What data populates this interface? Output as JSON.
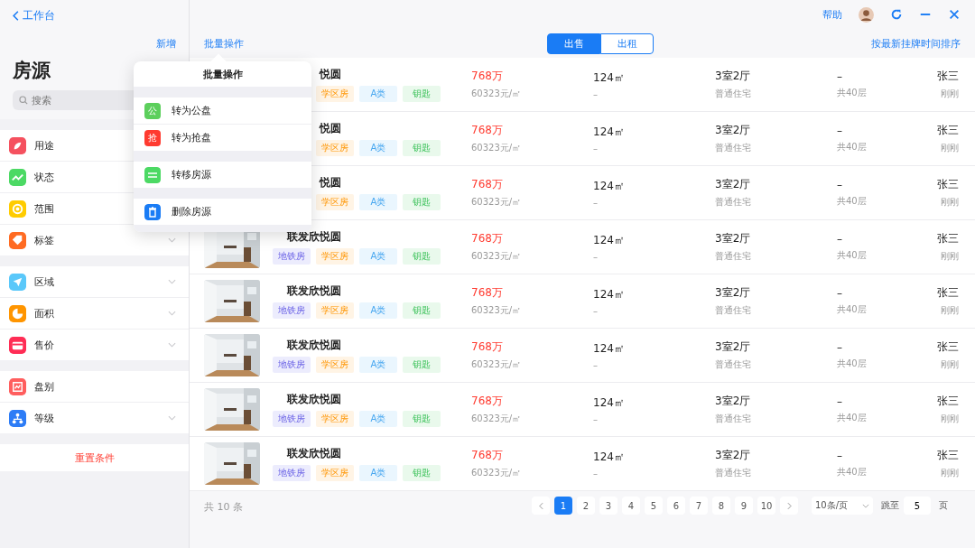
{
  "sidebar": {
    "back": "工作台",
    "add": "新增",
    "title": "房源",
    "search": {
      "placeholder": "搜索"
    },
    "groups": [
      {
        "items": [
          {
            "label": "用途",
            "kind": "leaf",
            "color": "#f5515f"
          },
          {
            "label": "状态",
            "kind": "trend",
            "color": "#4cd964"
          },
          {
            "label": "范围",
            "kind": "target",
            "color": "#ffcc00"
          },
          {
            "label": "标签",
            "kind": "tag",
            "color": "#ff6b22",
            "chevron": true
          }
        ]
      },
      {
        "items": [
          {
            "label": "区域",
            "kind": "arrow",
            "color": "#5ac8fa",
            "chevron": true
          },
          {
            "label": "面积",
            "kind": "pie",
            "color": "#ff9500",
            "chevron": true
          },
          {
            "label": "售价",
            "kind": "card",
            "color": "#ff2d55",
            "chevron": true
          }
        ]
      },
      {
        "items": [
          {
            "label": "盘别",
            "kind": "chart",
            "color": "#ff5e5e",
            "chevron": false
          },
          {
            "label": "等级",
            "kind": "tree",
            "color": "#2d7cf6",
            "chevron": true
          }
        ]
      }
    ],
    "reset": "重置条件"
  },
  "toolbar": {
    "batch": "批量操作",
    "segments": [
      {
        "label": "出售",
        "selected": true
      },
      {
        "label": "出租",
        "selected": false
      }
    ],
    "sort": "按最新挂牌时间排序",
    "help": "帮助"
  },
  "popover": {
    "title": "批量操作",
    "groups": [
      [
        {
          "label": "转为公盘",
          "kind": "char",
          "glyph": "公",
          "color": "#5ccf5c"
        },
        {
          "label": "转为抢盘",
          "kind": "char",
          "glyph": "抢",
          "color": "#ff3b30"
        }
      ],
      [
        {
          "label": "转移房源",
          "kind": "swap",
          "color": "#4cd964"
        }
      ],
      [
        {
          "label": "删除房源",
          "kind": "trash",
          "color": "#1a7cf5"
        }
      ]
    ]
  },
  "rows": [
    {
      "name": "悦圆",
      "tags": [
        "学区房",
        "A类",
        "钥匙"
      ],
      "price": "768万",
      "unit_price": "60323元/㎡",
      "area": "124㎡",
      "area_sub": "–",
      "layout": "3室2厅",
      "type": "普通住宅",
      "floor": "–",
      "floors": "共40层",
      "agent": "张三",
      "time": "刚刚"
    },
    {
      "name": "悦圆",
      "tags": [
        "学区房",
        "A类",
        "钥匙"
      ],
      "price": "768万",
      "unit_price": "60323元/㎡",
      "area": "124㎡",
      "area_sub": "–",
      "layout": "3室2厅",
      "type": "普通住宅",
      "floor": "–",
      "floors": "共40层",
      "agent": "张三",
      "time": "刚刚"
    },
    {
      "name": "悦圆",
      "tags": [
        "学区房",
        "A类",
        "钥匙"
      ],
      "price": "768万",
      "unit_price": "60323元/㎡",
      "area": "124㎡",
      "area_sub": "–",
      "layout": "3室2厅",
      "type": "普通住宅",
      "floor": "–",
      "floors": "共40层",
      "agent": "张三",
      "time": "刚刚"
    },
    {
      "name": "联发欣悦圆",
      "tags": [
        "地铁房",
        "学区房",
        "A类",
        "钥匙"
      ],
      "price": "768万",
      "unit_price": "60323元/㎡",
      "area": "124㎡",
      "area_sub": "–",
      "layout": "3室2厅",
      "type": "普通住宅",
      "floor": "–",
      "floors": "共40层",
      "agent": "张三",
      "time": "刚刚"
    },
    {
      "name": "联发欣悦圆",
      "tags": [
        "地铁房",
        "学区房",
        "A类",
        "钥匙"
      ],
      "price": "768万",
      "unit_price": "60323元/㎡",
      "area": "124㎡",
      "area_sub": "–",
      "layout": "3室2厅",
      "type": "普通住宅",
      "floor": "–",
      "floors": "共40层",
      "agent": "张三",
      "time": "刚刚"
    },
    {
      "name": "联发欣悦圆",
      "tags": [
        "地铁房",
        "学区房",
        "A类",
        "钥匙"
      ],
      "price": "768万",
      "unit_price": "60323元/㎡",
      "area": "124㎡",
      "area_sub": "–",
      "layout": "3室2厅",
      "type": "普通住宅",
      "floor": "–",
      "floors": "共40层",
      "agent": "张三",
      "time": "刚刚"
    },
    {
      "name": "联发欣悦圆",
      "tags": [
        "地铁房",
        "学区房",
        "A类",
        "钥匙"
      ],
      "price": "768万",
      "unit_price": "60323元/㎡",
      "area": "124㎡",
      "area_sub": "–",
      "layout": "3室2厅",
      "type": "普通住宅",
      "floor": "–",
      "floors": "共40层",
      "agent": "张三",
      "time": "刚刚"
    },
    {
      "name": "联发欣悦圆",
      "tags": [
        "地铁房",
        "学区房",
        "A类",
        "钥匙"
      ],
      "price": "768万",
      "unit_price": "60323元/㎡",
      "area": "124㎡",
      "area_sub": "–",
      "layout": "3室2厅",
      "type": "普通住宅",
      "floor": "–",
      "floors": "共40层",
      "agent": "张三",
      "time": "刚刚"
    }
  ],
  "footer": {
    "total": "共 10 条",
    "pages": [
      {
        "label": "1",
        "selected": true
      },
      {
        "label": "2",
        "selected": false
      },
      {
        "label": "3",
        "selected": false
      },
      {
        "label": "4",
        "selected": false
      },
      {
        "label": "5",
        "selected": false
      },
      {
        "label": "6",
        "selected": false
      },
      {
        "label": "7",
        "selected": false
      },
      {
        "label": "8",
        "selected": false
      },
      {
        "label": "9",
        "selected": false
      },
      {
        "label": "10",
        "selected": false
      }
    ],
    "page_size": "10条/页",
    "jump_label": "跳至",
    "jump_value": "5",
    "page_unit": "页"
  }
}
